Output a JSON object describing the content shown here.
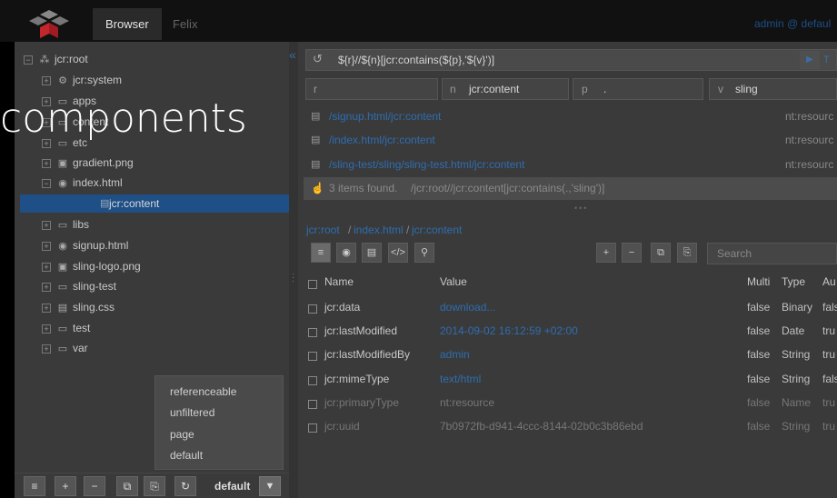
{
  "topbar": {
    "nav": [
      "Browser",
      "Felix"
    ],
    "user": "admin @ defaul"
  },
  "overlay_title": "components",
  "tree": [
    {
      "label": "jcr:root",
      "toggle": "⊟",
      "icon": "⁂"
    },
    {
      "label": "jcr:system",
      "toggle": "⊞",
      "icon": "⚙"
    },
    {
      "label": "apps",
      "toggle": "⊞",
      "icon": "▭"
    },
    {
      "label": "content",
      "toggle": "⊞",
      "icon": "▭"
    },
    {
      "label": "etc",
      "toggle": "⊞",
      "icon": "▭"
    },
    {
      "label": "gradient.png",
      "toggle": "⊞",
      "icon": "▣"
    },
    {
      "label": "index.html",
      "toggle": "⊟",
      "icon": "◉"
    },
    {
      "label": "libs",
      "toggle": "⊞",
      "icon": "▭"
    },
    {
      "label": "signup.html",
      "toggle": "⊞",
      "icon": "◉"
    },
    {
      "label": "sling-logo.png",
      "toggle": "⊞",
      "icon": "▣"
    },
    {
      "label": "sling-test",
      "toggle": "⊞",
      "icon": "▭"
    },
    {
      "label": "sling.css",
      "toggle": "⊞",
      "icon": "▤"
    },
    {
      "label": "test",
      "toggle": "⊞",
      "icon": "▭"
    },
    {
      "label": "var",
      "toggle": "⊞",
      "icon": "▭"
    }
  ],
  "tree_selected": "jcr:content",
  "filter_popup": [
    "referenceable",
    "unfiltered",
    "page",
    "default"
  ],
  "left_toolbar": {
    "buttons": [
      "≡",
      "+",
      "−",
      "⧉",
      "⎘",
      "↻"
    ],
    "filter_label": "default",
    "filter_icon": "▼"
  },
  "query": {
    "icon": "↺",
    "text": "${r}//${n}[jcr:contains(${p},'${v}')]",
    "run_icon": "▶",
    "filter_icon": "T"
  },
  "params": [
    {
      "label": "r",
      "value": ""
    },
    {
      "label": "n",
      "value": "jcr:content"
    },
    {
      "label": "p",
      "value": "."
    },
    {
      "label": "v",
      "value": "sling"
    }
  ],
  "results": [
    {
      "path": "/signup.html/jcr:content",
      "type": "nt:resourc"
    },
    {
      "path": "/index.html/jcr:content",
      "type": "nt:resourc"
    },
    {
      "path": "/sling-test/sling/sling-test.html/jcr:content",
      "type": "nt:resourc"
    }
  ],
  "results_found": {
    "count_text": "3 items found.",
    "path": "/jcr:root//jcr:content[jcr:contains(.,'sling')]"
  },
  "breadcrumb": [
    "jcr:root",
    "index.html",
    "jcr:content"
  ],
  "prop_toolbar": [
    "≡",
    "◉",
    "▤",
    "</>",
    "⚲"
  ],
  "prop_actions": [
    "+",
    "−",
    "⧉",
    "⎘"
  ],
  "search_placeholder": "Search",
  "table": {
    "headers": [
      "Name",
      "Value",
      "Multi",
      "Type",
      "Au"
    ],
    "rows": [
      {
        "name": "jcr:data",
        "value": "download...",
        "multi": "false",
        "type": "Binary",
        "auto": "fals",
        "link": true,
        "muted": false
      },
      {
        "name": "jcr:lastModified",
        "value": "2014-09-02 16:12:59 +02:00",
        "multi": "false",
        "type": "Date",
        "auto": "tru",
        "link": true,
        "muted": false
      },
      {
        "name": "jcr:lastModifiedBy",
        "value": "admin",
        "multi": "false",
        "type": "String",
        "auto": "tru",
        "link": true,
        "muted": false
      },
      {
        "name": "jcr:mimeType",
        "value": "text/html",
        "multi": "false",
        "type": "String",
        "auto": "fals",
        "link": true,
        "muted": false
      },
      {
        "name": "jcr:primaryType",
        "value": "nt:resource",
        "multi": "false",
        "type": "Name",
        "auto": "tru",
        "link": false,
        "muted": true
      },
      {
        "name": "jcr:uuid",
        "value": "7b0972fb-d941-4ccc-8144-02b0c3b86ebd",
        "multi": "false",
        "type": "String",
        "auto": "tru",
        "link": false,
        "muted": true
      }
    ]
  }
}
